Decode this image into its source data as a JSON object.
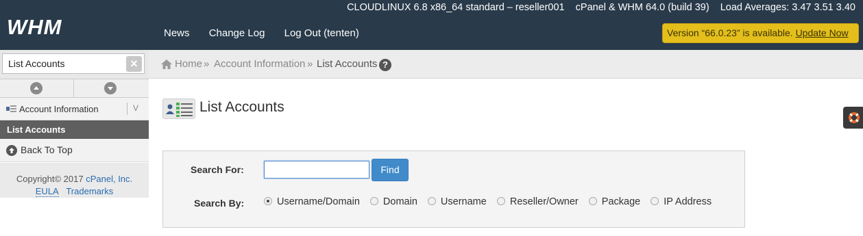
{
  "header": {
    "logo": "WHM",
    "system_info": "CLOUDLINUX 6.8 x86_64 standard – reseller001",
    "version_info": "cPanel & WHM 64.0 (build 39)",
    "load_averages": "Load Averages: 3.47 3.51 3.40",
    "nav": {
      "news": "News",
      "change_log": "Change Log",
      "logout": "Log Out (tenten)"
    },
    "update": {
      "text": "Version “66.0.23” is available.",
      "link": "Update Now",
      "color": "#e4bf1b"
    }
  },
  "sidebar": {
    "search_value": "List Accounts",
    "category": "Account Information",
    "active_item": "List Accounts",
    "back_to_top": "Back To Top",
    "footer": {
      "copyright": "Copyright© 2017",
      "company": "cPanel, Inc.",
      "eula": "EULA",
      "trademarks": "Trademarks"
    }
  },
  "breadcrumb": {
    "home": "Home",
    "separator": "»",
    "section": "Account Information",
    "current": "List Accounts"
  },
  "page": {
    "title": "List Accounts"
  },
  "search": {
    "for_label": "Search For:",
    "input_value": "",
    "find_label": "Find",
    "by_label": "Search By:",
    "options": [
      "Username/Domain",
      "Domain",
      "Username",
      "Reseller/Owner",
      "Package",
      "IP Address"
    ],
    "selected": "Username/Domain"
  },
  "colors": {
    "header_bg": "#293a4a",
    "active_item_bg": "#5f5f5f",
    "button": "#428bca"
  }
}
